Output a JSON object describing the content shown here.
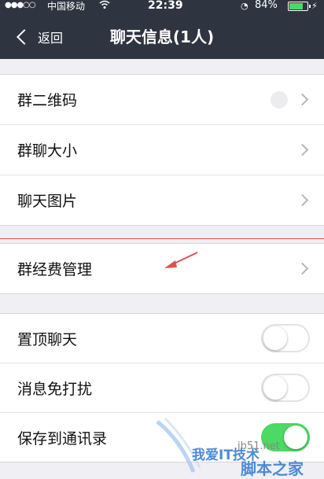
{
  "status_bar": {
    "carrier": "中国移动",
    "time": "22:39",
    "battery_text": "84%",
    "battery_level": 0.84,
    "signal_dots": "●●●○○",
    "wifi_icon": "wifi-icon",
    "alarm_icon": "alarm-icon",
    "charging_icon": "charging-icon"
  },
  "nav": {
    "back_label": "返回",
    "title": "聊天信息(1人)"
  },
  "group1": {
    "items": [
      {
        "label": "群二维码"
      },
      {
        "label": "群聊大小"
      },
      {
        "label": "聊天图片"
      }
    ]
  },
  "group2": {
    "items": [
      {
        "label": "群经费管理"
      }
    ]
  },
  "group3": {
    "items": [
      {
        "label": "置顶聊天",
        "on": false
      },
      {
        "label": "消息免打扰",
        "on": false
      },
      {
        "label": "保存到通讯录",
        "on": true
      }
    ]
  },
  "watermark": {
    "text1": "我爱IT技术",
    "text2": "jb51.net",
    "text3": "脚本之家"
  },
  "colors": {
    "nav_bg": "#2f3540",
    "toggle_on": "#4cd964",
    "annotation": "#e05050"
  }
}
